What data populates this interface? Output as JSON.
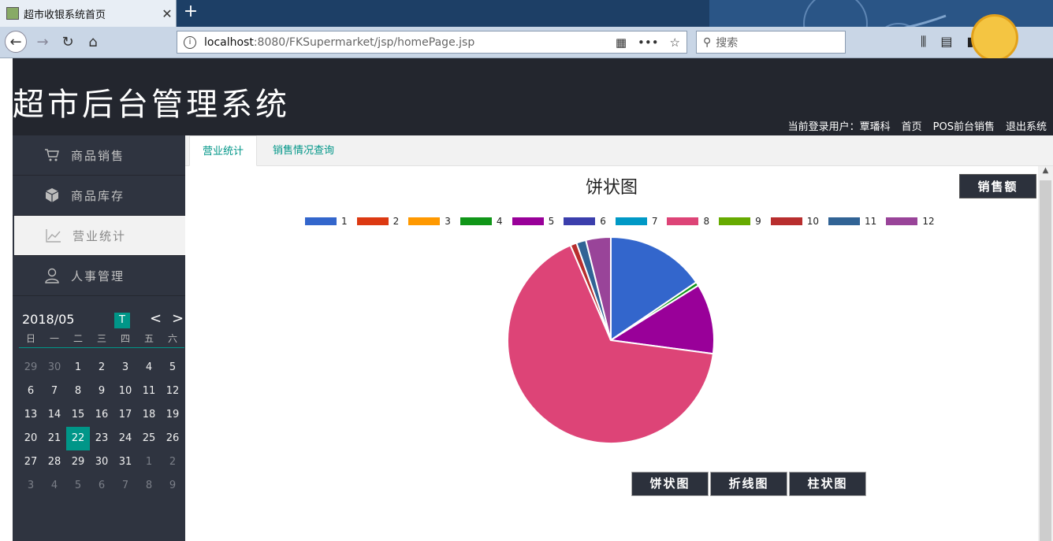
{
  "browser": {
    "tab_title": "超市收银系统首页",
    "url_host": "localhost",
    "url_path": ":8080/FKSupermarket/jsp/homePage.jsp",
    "search_placeholder": "搜索"
  },
  "header": {
    "title": "超市后台管理系统",
    "user_label": "当前登录用户：",
    "user_name": "覃璠科",
    "links": [
      "首页",
      "POS前台销售",
      "退出系统"
    ]
  },
  "sidebar": {
    "items": [
      {
        "label": "商品销售",
        "icon": "cart-icon"
      },
      {
        "label": "商品库存",
        "icon": "box-icon"
      },
      {
        "label": "营业统计",
        "icon": "chart-line-icon"
      },
      {
        "label": "人事管理",
        "icon": "person-icon"
      }
    ],
    "active_index": 2
  },
  "calendar": {
    "month": "2018/05",
    "today_label": "T",
    "prev": "<",
    "next": ">",
    "weekdays": [
      "日",
      "一",
      "二",
      "三",
      "四",
      "五",
      "六"
    ],
    "days": [
      [
        "29",
        "30",
        "1",
        "2",
        "3",
        "4",
        "5"
      ],
      [
        "6",
        "7",
        "8",
        "9",
        "10",
        "11",
        "12"
      ],
      [
        "13",
        "14",
        "15",
        "16",
        "17",
        "18",
        "19"
      ],
      [
        "20",
        "21",
        "22",
        "23",
        "24",
        "25",
        "26"
      ],
      [
        "27",
        "28",
        "29",
        "30",
        "31",
        "1",
        "2"
      ],
      [
        "3",
        "4",
        "5",
        "6",
        "7",
        "8",
        "9"
      ]
    ],
    "selected": "22"
  },
  "tabs": [
    "营业统计",
    "销售情况查询"
  ],
  "metric_button": "销售额",
  "chart_buttons": [
    "饼状图",
    "折线图",
    "柱状图"
  ],
  "chart_data": {
    "type": "pie",
    "title": "饼状图",
    "legend_placement": "top",
    "categories": [
      "1",
      "2",
      "3",
      "4",
      "5",
      "6",
      "7",
      "8",
      "9",
      "10",
      "11",
      "12"
    ],
    "values": [
      15.5,
      0,
      0,
      0.6,
      11.0,
      0,
      0,
      66.5,
      0,
      1.0,
      1.5,
      3.9
    ],
    "colors": [
      "#3366cc",
      "#dc3912",
      "#ff9900",
      "#109618",
      "#990099",
      "#3b3eac",
      "#0099c6",
      "#dd4477",
      "#66aa00",
      "#b82e2e",
      "#316395",
      "#994499"
    ]
  }
}
